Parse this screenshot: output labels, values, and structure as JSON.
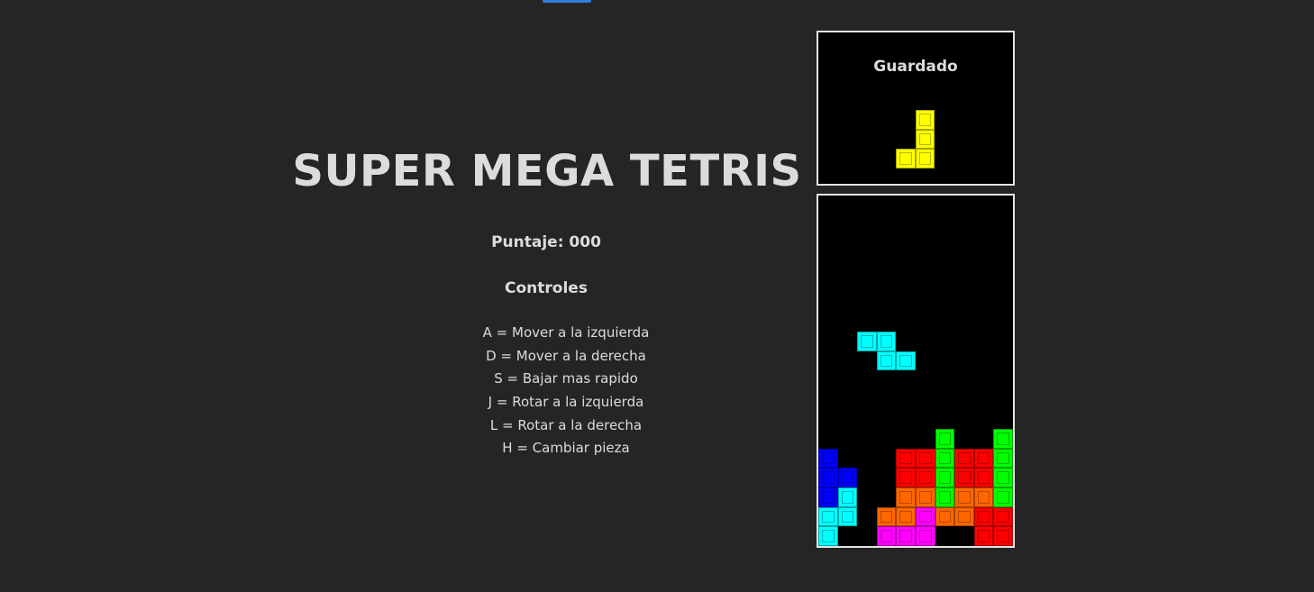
{
  "game": {
    "title": "SUPER MEGA TETRIS",
    "score_text": "Puntaje: 000",
    "controls_title": "Controles",
    "controls": [
      "A = Mover a la izquierda",
      "D = Mover a la derecha",
      "S = Bajar mas rapido",
      "J = Rotar a la izquierda",
      "L = Rotar a la derecha",
      "H = Cambiar pieza"
    ],
    "hold_label": "Guardado"
  },
  "colors": {
    "background": "#252525",
    "panel_border": "#e4e4e4",
    "yellow": "#ffff00",
    "cyan": "#00ffff",
    "blue": "#0000ff",
    "red": "#ff0000",
    "green": "#00ff00",
    "orange": "#ff6600",
    "magenta": "#ff00ff"
  },
  "hold_piece": {
    "color": "yellow",
    "cells": [
      [
        1,
        0
      ],
      [
        1,
        1
      ],
      [
        0,
        2
      ],
      [
        1,
        2
      ]
    ]
  },
  "active_piece": {
    "color": "cyan",
    "cells": [
      [
        2,
        7
      ],
      [
        3,
        7
      ],
      [
        3,
        8
      ],
      [
        4,
        8
      ]
    ]
  },
  "board": {
    "cols": 10,
    "rows": 18,
    "cells": [
      {
        "col": 6,
        "row": 12,
        "color": "green"
      },
      {
        "col": 9,
        "row": 12,
        "color": "green"
      },
      {
        "col": 0,
        "row": 13,
        "color": "blue"
      },
      {
        "col": 4,
        "row": 13,
        "color": "red"
      },
      {
        "col": 5,
        "row": 13,
        "color": "red"
      },
      {
        "col": 6,
        "row": 13,
        "color": "green"
      },
      {
        "col": 7,
        "row": 13,
        "color": "red"
      },
      {
        "col": 8,
        "row": 13,
        "color": "red"
      },
      {
        "col": 9,
        "row": 13,
        "color": "green"
      },
      {
        "col": 0,
        "row": 14,
        "color": "blue"
      },
      {
        "col": 1,
        "row": 14,
        "color": "blue"
      },
      {
        "col": 4,
        "row": 14,
        "color": "red"
      },
      {
        "col": 5,
        "row": 14,
        "color": "red"
      },
      {
        "col": 6,
        "row": 14,
        "color": "green"
      },
      {
        "col": 7,
        "row": 14,
        "color": "red"
      },
      {
        "col": 8,
        "row": 14,
        "color": "red"
      },
      {
        "col": 9,
        "row": 14,
        "color": "green"
      },
      {
        "col": 0,
        "row": 15,
        "color": "blue"
      },
      {
        "col": 1,
        "row": 15,
        "color": "cyan"
      },
      {
        "col": 4,
        "row": 15,
        "color": "orange"
      },
      {
        "col": 5,
        "row": 15,
        "color": "orange"
      },
      {
        "col": 6,
        "row": 15,
        "color": "green"
      },
      {
        "col": 7,
        "row": 15,
        "color": "orange"
      },
      {
        "col": 8,
        "row": 15,
        "color": "orange"
      },
      {
        "col": 9,
        "row": 15,
        "color": "green"
      },
      {
        "col": 0,
        "row": 16,
        "color": "cyan"
      },
      {
        "col": 1,
        "row": 16,
        "color": "cyan"
      },
      {
        "col": 3,
        "row": 16,
        "color": "orange"
      },
      {
        "col": 4,
        "row": 16,
        "color": "orange"
      },
      {
        "col": 5,
        "row": 16,
        "color": "magenta"
      },
      {
        "col": 6,
        "row": 16,
        "color": "orange"
      },
      {
        "col": 7,
        "row": 16,
        "color": "orange"
      },
      {
        "col": 8,
        "row": 16,
        "color": "red"
      },
      {
        "col": 9,
        "row": 16,
        "color": "red"
      },
      {
        "col": 0,
        "row": 17,
        "color": "cyan"
      },
      {
        "col": 3,
        "row": 17,
        "color": "magenta"
      },
      {
        "col": 4,
        "row": 17,
        "color": "magenta"
      },
      {
        "col": 5,
        "row": 17,
        "color": "magenta"
      },
      {
        "col": 8,
        "row": 17,
        "color": "red"
      },
      {
        "col": 9,
        "row": 17,
        "color": "red"
      }
    ]
  }
}
